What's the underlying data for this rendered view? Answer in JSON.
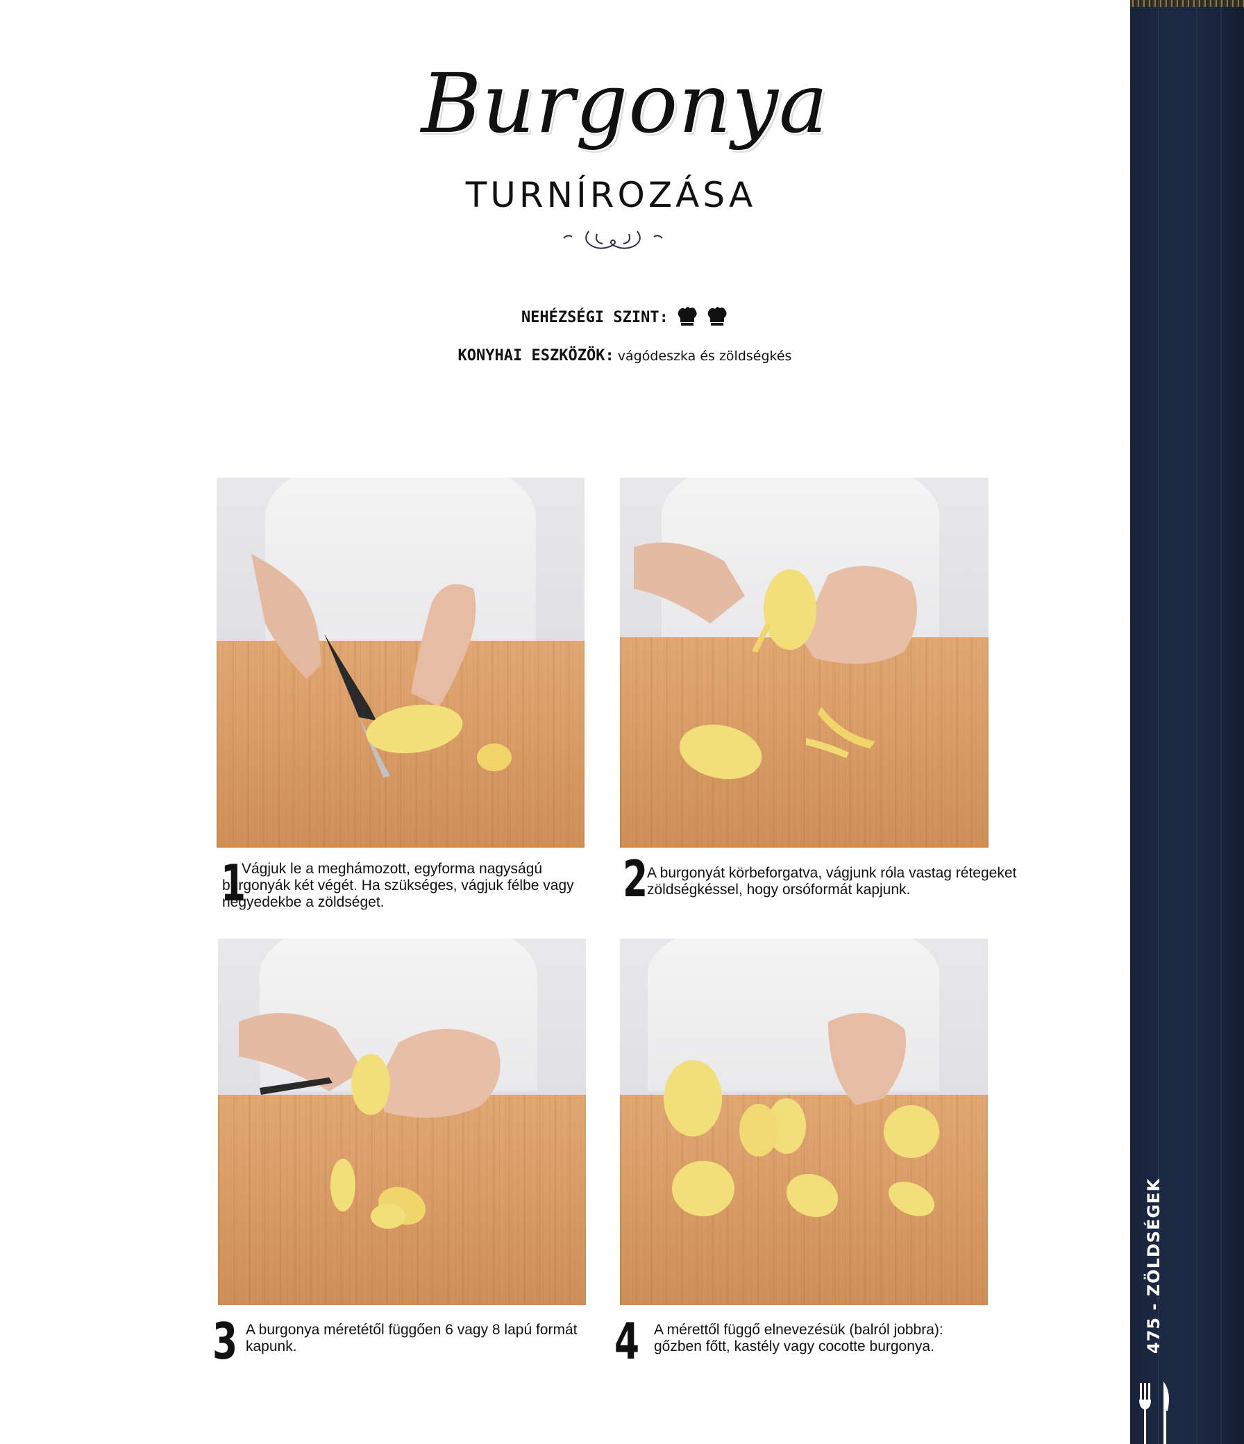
{
  "title": {
    "script": "Burgonya",
    "subtitle": "TURNÍROZÁSA"
  },
  "difficulty": {
    "label": "NEHÉZSÉGI SZINT:",
    "level": 2,
    "icon": "chef-hat-icon"
  },
  "tools": {
    "label": "KONYHAI ESZKÖZÖK:",
    "value": "vágódeszka és zöldségkés"
  },
  "steps": [
    {
      "number": "1",
      "text": "Vágjuk le a meghámozott, egyforma nagyságú burgonyák két végét. Ha szükséges, vágjuk félbe vagy negyedekbe a zöldséget."
    },
    {
      "number": "2",
      "text": "A burgonyát körbeforgatva, vágjunk róla vastag rétegeket zöldségkéssel, hogy orsóformát kapjunk."
    },
    {
      "number": "3",
      "text": "A burgonya méretétől függően 6 vagy 8 lapú formát kapunk."
    },
    {
      "number": "4",
      "text": "A mérettől függő elnevezésük (balról jobbra): gőzben főtt, kastély vagy cocotte burgonya."
    }
  ],
  "side_tab": {
    "label": "475 - ZÖLDSÉGEK",
    "icon": "cutlery-icon"
  },
  "colors": {
    "side_band": "#1b2741",
    "text": "#111111",
    "cutting_board": "#d99c66",
    "potato": "#f3df7a"
  }
}
